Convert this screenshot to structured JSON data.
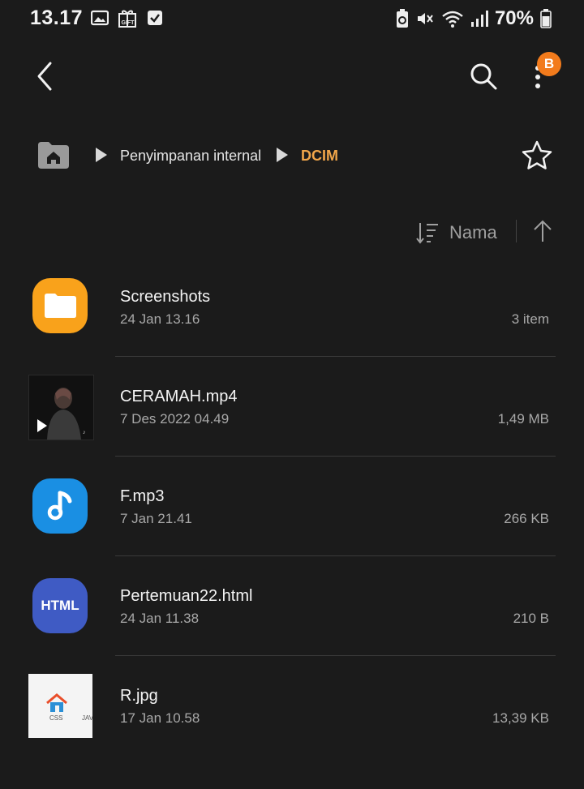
{
  "status_bar": {
    "time": "13.17",
    "battery": "70%",
    "icons": [
      "image-icon",
      "gift-icon",
      "checkbox-icon",
      "battery-saver-icon",
      "mute-icon",
      "wifi-icon",
      "signal-icon",
      "battery-icon"
    ]
  },
  "toolbar": {
    "badge": "B"
  },
  "breadcrumb": {
    "items": [
      "Penyimpanan internal",
      "DCIM"
    ]
  },
  "sort": {
    "label": "Nama"
  },
  "files": [
    {
      "name": "Screenshots",
      "date": "24 Jan 13.16",
      "meta": "3 item",
      "type": "folder"
    },
    {
      "name": "CERAMAH.mp4",
      "date": "7 Des 2022 04.49",
      "meta": "1,49 MB",
      "type": "video"
    },
    {
      "name": "F.mp3",
      "date": "7 Jan 21.41",
      "meta": "266 KB",
      "type": "audio"
    },
    {
      "name": "Pertemuan22.html",
      "date": "24 Jan 11.38",
      "meta": "210 B",
      "type": "html",
      "icon_text": "HTML"
    },
    {
      "name": "R.jpg",
      "date": "17 Jan 10.58",
      "meta": "13,39 KB",
      "type": "image",
      "thumb_text": [
        "CSS",
        "JAV"
      ]
    }
  ],
  "colors": {
    "background": "#1b1b1b",
    "accent": "#f1a64a",
    "folder": "#f9a21b",
    "audio": "#1a8fe3",
    "html": "#3f5bc4",
    "badge": "#f27b1c"
  }
}
